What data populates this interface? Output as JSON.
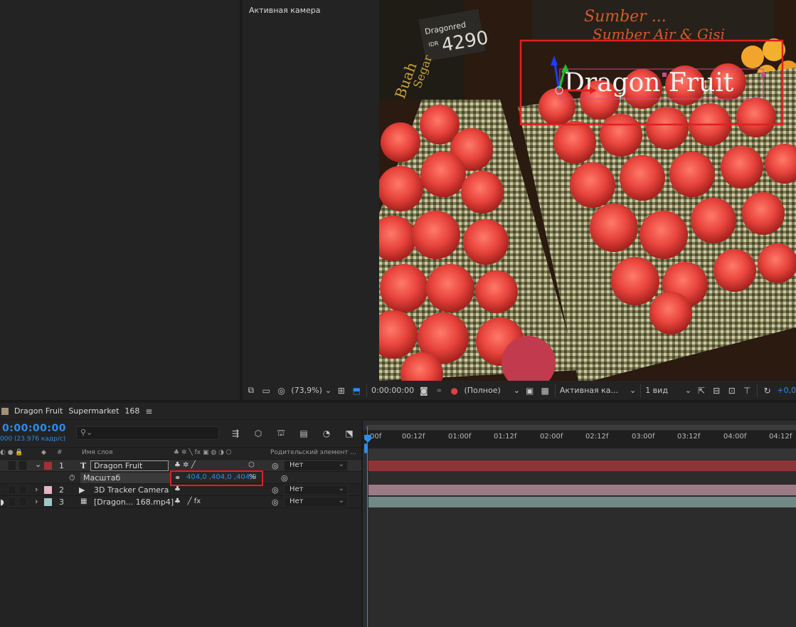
{
  "viewer": {
    "camera_label": "Активная камера",
    "scene": {
      "sign1_line1": "Sumber ...",
      "sign1_line2": "Sumber Air & Gisi",
      "price_tag_title": "Dragonred",
      "price_tag_currency": "IDR",
      "price_tag_value": "4290",
      "chalk_word1": "Buah",
      "chalk_word2": "Segar",
      "overlay_text": "Dragon Fruit"
    }
  },
  "viewer_toolbar": {
    "zoom": "(73,9%)",
    "timecode": "0:00:00:00",
    "resolution": "(Полное)",
    "camera": "Активная ка...",
    "views": "1 вид",
    "exposure": "+0,0"
  },
  "timeline": {
    "tabs": [
      "Dragon Fruit",
      "Supermarket",
      "168"
    ],
    "current_time": "0:00:00:00",
    "fps_label": "000 (23.976 кадр/с)",
    "search_placeholder": "",
    "columns": {
      "num": "#",
      "layer_name": "Имя слоя",
      "parent": "Родительский элемент ..."
    },
    "ruler_ticks": [
      "00f",
      "00:12f",
      "01:00f",
      "01:12f",
      "02:00f",
      "02:12f",
      "03:00f",
      "03:12f",
      "04:00f",
      "04:12f"
    ],
    "layers": [
      {
        "index": "1",
        "type_icon": "T",
        "name": "Dragon Fruit",
        "parent": "Нет",
        "label_color": "#a62f2f",
        "bar_color": "#8e3437"
      },
      {
        "index": "",
        "type_icon": "",
        "name": "Масштаб",
        "value": "404,0 ,404,0 ,404,0",
        "unit": "%"
      },
      {
        "index": "2",
        "type_icon": "camera",
        "name": "3D Tracker Camera",
        "parent": "Нет",
        "label_color": "#e8b4c0",
        "bar_color": "#9a7b86"
      },
      {
        "index": "3",
        "type_icon": "footage",
        "name": "[Dragon... 168.mp4]",
        "parent": "Нет",
        "label_color": "#9fc8c4",
        "bar_color": "#6f8986"
      }
    ]
  },
  "colors": {
    "accent_blue": "#2d8ceb",
    "highlight_red": "#e02020"
  }
}
